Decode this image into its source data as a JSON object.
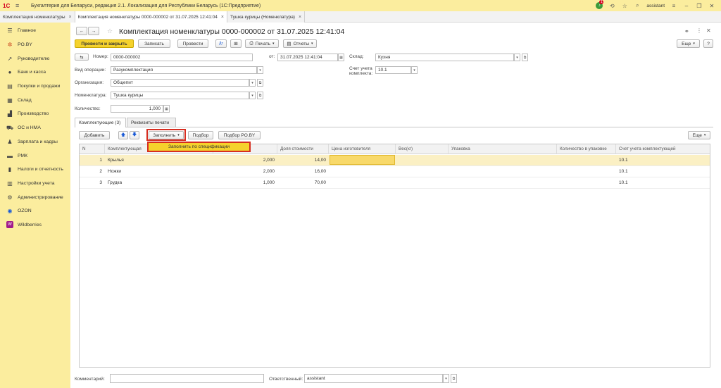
{
  "titlebar": {
    "logo": "1С",
    "app_title": "Бухгалтерия для Беларуси, редакция 2.1. Локализация для Республики Беларусь   (1С:Предприятие)",
    "notification_count": "1",
    "user": "assistant"
  },
  "tabs": [
    {
      "label": "Комплектация номенклатуры"
    },
    {
      "label": "Комплектация номенклатуры 0000-000002 от 31.07.2025 12:41:04"
    },
    {
      "label": "Тушка курицы (Номенклатура)"
    }
  ],
  "sidebar": {
    "items": [
      {
        "label": "Главное",
        "icon": "menu-icon"
      },
      {
        "label": "PO.BY",
        "icon": "poby-icon"
      },
      {
        "label": "Руководителю",
        "icon": "chart-icon"
      },
      {
        "label": "Банк и касса",
        "icon": "bank-icon"
      },
      {
        "label": "Покупки и продажи",
        "icon": "cart-icon"
      },
      {
        "label": "Склад",
        "icon": "warehouse-icon"
      },
      {
        "label": "Производство",
        "icon": "factory-icon"
      },
      {
        "label": "ОС и НМА",
        "icon": "assets-icon"
      },
      {
        "label": "Зарплата и кадры",
        "icon": "salary-icon"
      },
      {
        "label": "РМК",
        "icon": "cashdesk-icon"
      },
      {
        "label": "Налоги и отчетность",
        "icon": "taxes-icon"
      },
      {
        "label": "Настройки учета",
        "icon": "settings-icon"
      },
      {
        "label": "Администрирование",
        "icon": "gear-icon"
      },
      {
        "label": "OZON",
        "icon": "ozon-icon"
      },
      {
        "label": "Wildberries",
        "icon": "wildberries-icon"
      }
    ]
  },
  "doc": {
    "title": "Комплектация номенклатуры 0000-000002 от 31.07.2025 12:41:04",
    "toolbar": {
      "post_close": "Провести и закрыть",
      "save": "Записать",
      "post": "Провести",
      "print": "Печать",
      "reports": "Отчеты",
      "more": "Еще",
      "help": "?"
    },
    "fields": {
      "number_label": "Номер:",
      "number": "0000-000002",
      "date_label": "от:",
      "date": "31.07.2025 12:41:04",
      "warehouse_label": "Склад:",
      "warehouse": "Кухня",
      "op_label": "Вид операции:",
      "op": "Разукомплектация",
      "account_label": "Счет учета комплекта:",
      "account": "10.1",
      "org_label": "Организация:",
      "org": "Общепит",
      "item_label": "Номенклатура:",
      "item": "Тушка курицы",
      "qty_label": "Количество:",
      "qty": "1,000"
    },
    "form_tabs": [
      {
        "label": "Комплектующие (3)"
      },
      {
        "label": "Реквизиты печати"
      }
    ],
    "table_toolbar": {
      "add": "Добавить",
      "fill": "Заполнить",
      "pick": "Подбор",
      "pick_poby": "Подбор PO.BY",
      "more": "Еще"
    },
    "fill_menu_item": "Заполнить по спецификации",
    "columns": [
      "N",
      "Комплектующая",
      "",
      "Доля стоимости",
      "Цена изготовителя",
      "Вес(кг)",
      "Упаковка",
      "Количество в упаковке",
      "Счет учета комплектующей"
    ],
    "rows": [
      {
        "n": "1",
        "name": "Крылья",
        "qty": "2,000",
        "share": "14,00",
        "account": "10.1"
      },
      {
        "n": "2",
        "name": "Ножки",
        "qty": "2,000",
        "share": "16,00",
        "account": "10.1"
      },
      {
        "n": "3",
        "name": "Грудка",
        "qty": "1,000",
        "share": "70,00",
        "account": "10.1"
      }
    ],
    "footer": {
      "comment_label": "Комментарий:",
      "comment": "",
      "responsible_label": "Ответственный:",
      "responsible": "assistant"
    }
  }
}
